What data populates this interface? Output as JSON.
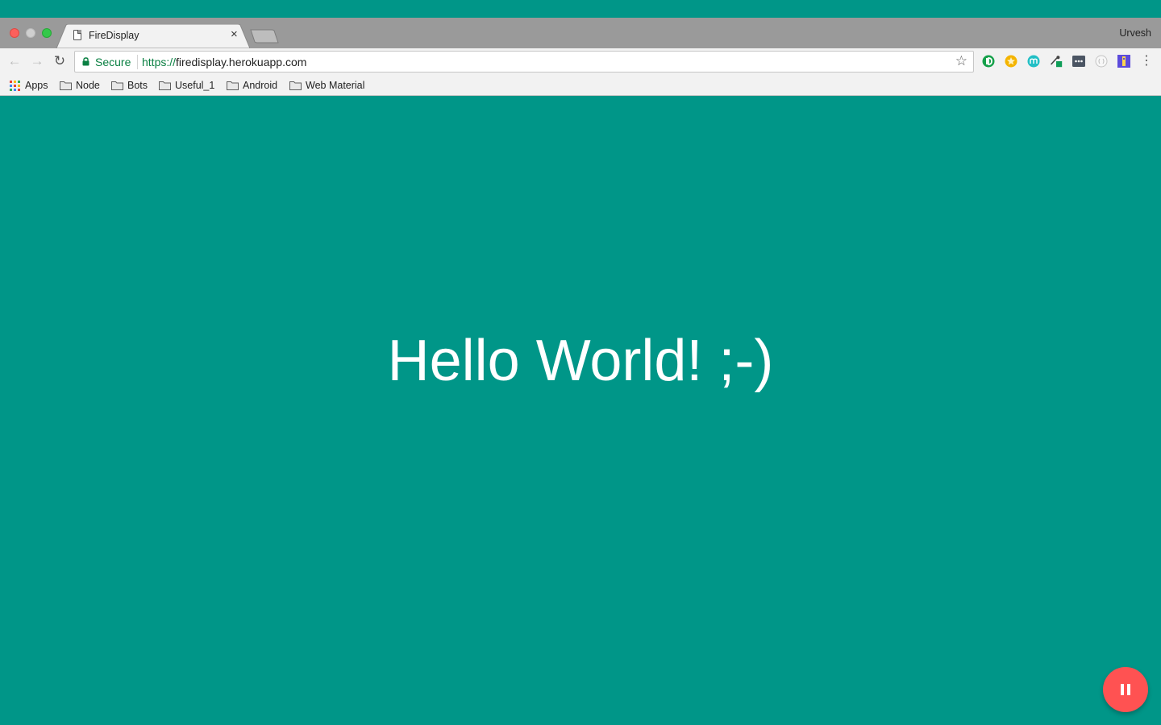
{
  "browser": {
    "tab_title": "FireDisplay",
    "tab_close": "×",
    "profile_name": "Urvesh",
    "omnibox": {
      "secure_label": "Secure",
      "url_scheme": "https://",
      "url_host": "firedisplay.herokuapp.com"
    },
    "nav": {
      "back": "←",
      "forward": "→",
      "reload": "↻"
    },
    "star": "☆",
    "menu": "⋮",
    "bookmarks": [
      {
        "label": "Apps",
        "icon": "apps-grid-icon"
      },
      {
        "label": "Node",
        "icon": "folder-icon"
      },
      {
        "label": "Bots",
        "icon": "folder-icon"
      },
      {
        "label": "Useful_1",
        "icon": "folder-icon"
      },
      {
        "label": "Android",
        "icon": "folder-icon"
      },
      {
        "label": "Web Material",
        "icon": "folder-icon"
      }
    ],
    "extensions": [
      "grammarly-extension-icon",
      "star-badge-extension-icon",
      "m-extension-icon",
      "eyedropper-extension-icon",
      "dots-extension-icon",
      "circle-extension-icon",
      "flag-extension-icon"
    ]
  },
  "page": {
    "message": "Hello World! ;-)",
    "background_color": "#009688",
    "fab_color": "#ff5252",
    "fab_icon": "pause-icon"
  }
}
